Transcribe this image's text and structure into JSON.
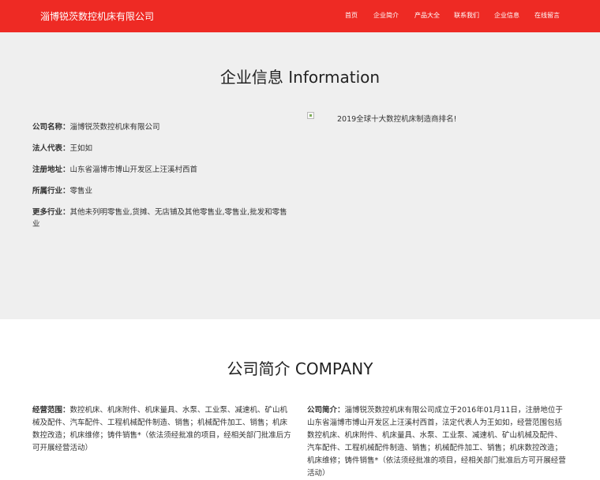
{
  "header": {
    "brand": "淄博锐茨数控机床有限公司",
    "nav": [
      {
        "label": "首页"
      },
      {
        "label": "企业简介"
      },
      {
        "label": "产品大全"
      },
      {
        "label": "联系我们"
      },
      {
        "label": "企业信息"
      },
      {
        "label": "在线留言"
      }
    ],
    "bg_color": "#ee2a24"
  },
  "info": {
    "title": "企业信息 Information",
    "rows": [
      {
        "label": "公司名称：",
        "value": "淄博锐茨数控机床有限公司"
      },
      {
        "label": "法人代表：",
        "value": "王如如"
      },
      {
        "label": "注册地址：",
        "value": "山东省淄博市博山开发区上汪溪村西首"
      },
      {
        "label": "所属行业：",
        "value": "零售业"
      },
      {
        "label": "更多行业：",
        "value": "其他未列明零售业,货摊、无店铺及其他零售业,零售业,批发和零售业"
      }
    ],
    "image_alt": "2019全球十大数控机床制造商排名!",
    "image_icon": "broken-image-icon"
  },
  "company": {
    "title": "公司简介 COMPANY",
    "scope_label": "经营范围：",
    "scope_text": "数控机床、机床附件、机床量具、水泵、工业泵、减速机、矿山机械及配件、汽车配件、工程机械配件制造、销售；机械配件加工、销售；机床数控改造；机床维修；铸件销售*（依法须经批准的项目，经相关部门批准后方可开展经营活动）",
    "intro_label": "公司简介：",
    "intro_text": "淄博锐茨数控机床有限公司成立于2016年01月11日，注册地位于山东省淄博市博山开发区上汪溪村西首，法定代表人为王如如，经营范围包括数控机床、机床附件、机床量具、水泵、工业泵、减速机、矿山机械及配件、汽车配件、工程机械配件制造、销售；机械配件加工、销售；机床数控改造；机床维修；铸件销售*（依法须经批准的项目，经相关部门批准后方可开展经营活动）"
  }
}
